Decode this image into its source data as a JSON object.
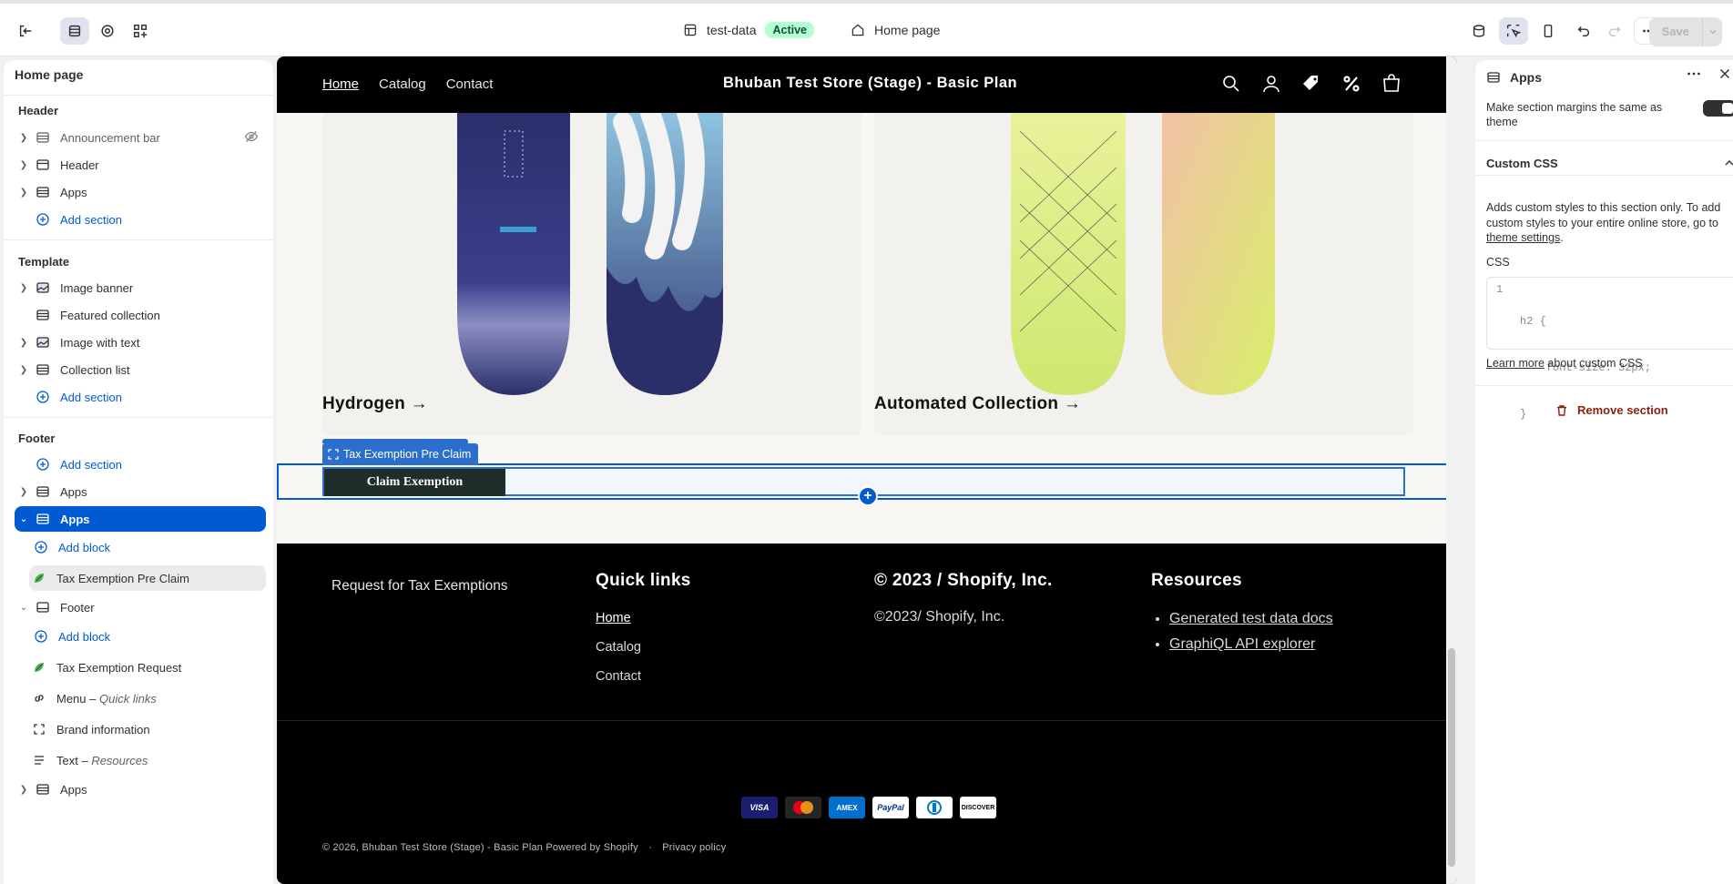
{
  "topbar": {
    "theme_name": "test-data",
    "status_badge": "Active",
    "page_selector": "Home page",
    "save_label": "Save"
  },
  "left_panel": {
    "title": "Home page",
    "groups": {
      "header": "Header",
      "template": "Template",
      "footer": "Footer"
    },
    "header_items": [
      "Announcement bar",
      "Header",
      "Apps"
    ],
    "add_section": "Add section",
    "template_items": [
      "Image banner",
      "Featured collection",
      "Image with text",
      "Collection list"
    ],
    "footer_items": {
      "apps_1": "Apps",
      "apps_selected": "Apps",
      "add_block": "Add block",
      "tax_pre_claim": "Tax Exemption Pre Claim",
      "footer": "Footer",
      "tax_request": "Tax Exemption Request",
      "menu": "Menu",
      "menu_sub": "Quick links",
      "brand": "Brand information",
      "text": "Text",
      "text_sub": "Resources",
      "apps_last": "Apps"
    },
    "separator": " – "
  },
  "preview": {
    "nav": [
      "Home",
      "Catalog",
      "Contact"
    ],
    "store_title": "Bhuban Test Store (Stage) - Basic Plan",
    "collections": [
      "Hydrogen →",
      "Automated Collection →"
    ],
    "block_tag": "Tax Exemption Pre Claim",
    "claim_button": "Claim Exemption",
    "footer": {
      "request_text": "Request for Tax Exemptions",
      "quick_links_heading": "Quick links",
      "quick_links": [
        "Home",
        "Catalog",
        "Contact"
      ],
      "brand_heading": "© 2023 / Shopify, Inc.",
      "brand_text": "©2023/ Shopify, Inc.",
      "resources_heading": "Resources",
      "resources": [
        "Generated test data docs",
        "GraphiQL API explorer"
      ],
      "payment_icons": [
        "VISA",
        "mastercard",
        "AMEX",
        "PayPal",
        "Diners",
        "DISCOVER"
      ],
      "copyright": "© 2026, Bhuban Test Store (Stage) - Basic Plan Powered by Shopify",
      "privacy": "Privacy policy"
    }
  },
  "right_panel": {
    "title": "Apps",
    "margins_label": "Make section margins the same as theme",
    "margins_on": true,
    "custom_css_heading": "Custom CSS",
    "custom_css_desc": "Adds custom styles to this section only. To add custom styles to your entire online store, go to ",
    "theme_settings_link": "theme settings",
    "css_label": "CSS",
    "css_code": [
      "h2 {",
      "    font-size: 32px;",
      "}"
    ],
    "learn_more": "Learn more",
    "learn_more_suffix": " about custom CSS",
    "remove_section": "Remove section"
  },
  "colors": {
    "accent": "#005bd3",
    "store_black": "#000000",
    "active_badge": "#b4fed2",
    "remove": "#8e1f0b"
  }
}
